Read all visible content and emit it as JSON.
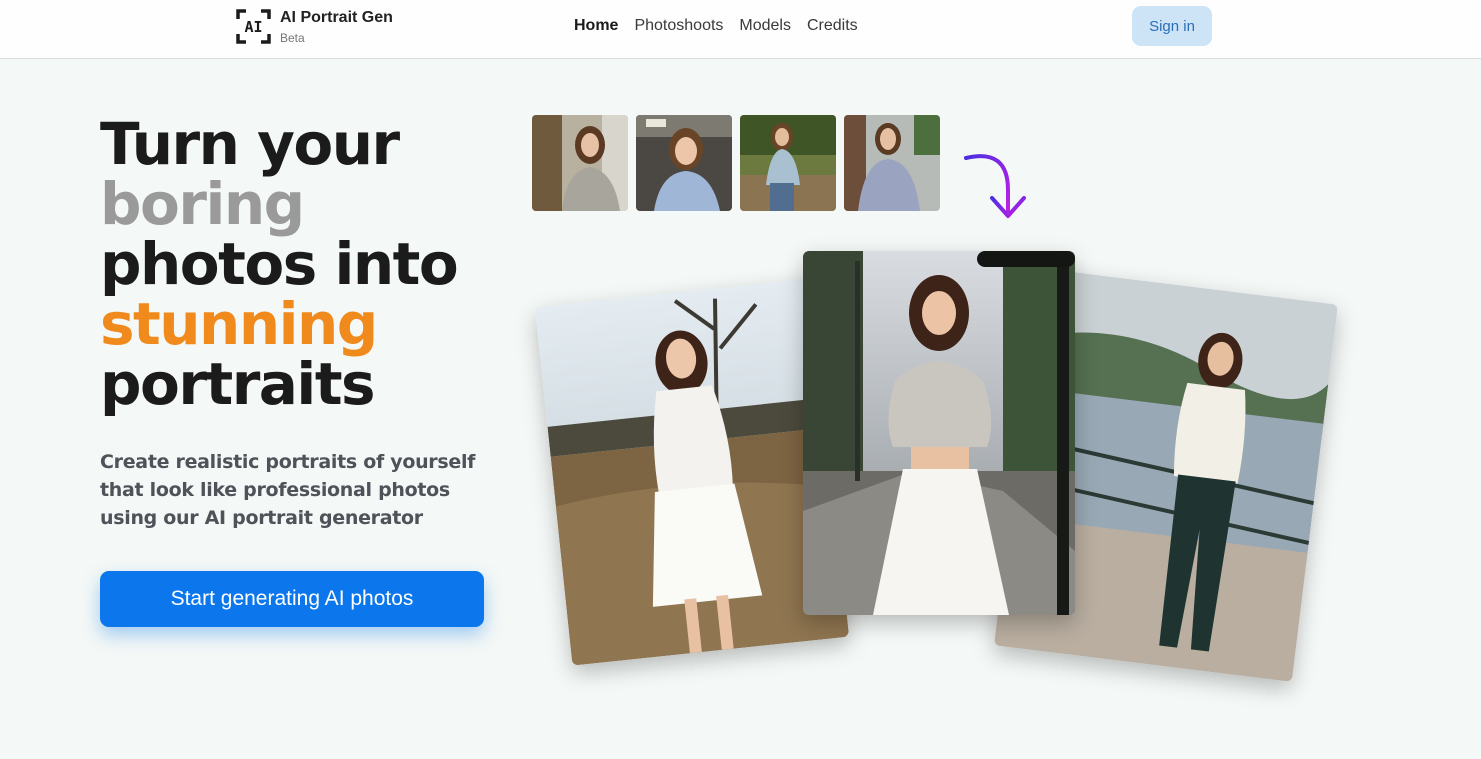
{
  "header": {
    "logo_mark": "AI",
    "app_title": "AI Portrait Gen",
    "app_badge": "Beta",
    "nav": [
      {
        "label": "Home",
        "active": true
      },
      {
        "label": "Photoshoots",
        "active": false
      },
      {
        "label": "Models",
        "active": false
      },
      {
        "label": "Credits",
        "active": false
      }
    ],
    "signin_label": "Sign in"
  },
  "hero": {
    "headline": {
      "line1": "Turn your",
      "line2": "boring",
      "line3": "photos into",
      "line4": "stunning",
      "line5": "portraits"
    },
    "subtext": "Create realistic portraits of yourself that look like professional photos using our AI portrait generator",
    "cta_label": "Start generating AI photos"
  },
  "colors": {
    "accent_blue": "#0c77ec",
    "highlight_orange": "#f18a1c",
    "muted_gray": "#9a9a9a",
    "arrow_purple": "#8a2be2"
  },
  "icons": {
    "logo": "ai-frame-icon",
    "arrow": "curved-arrow-down-icon"
  }
}
